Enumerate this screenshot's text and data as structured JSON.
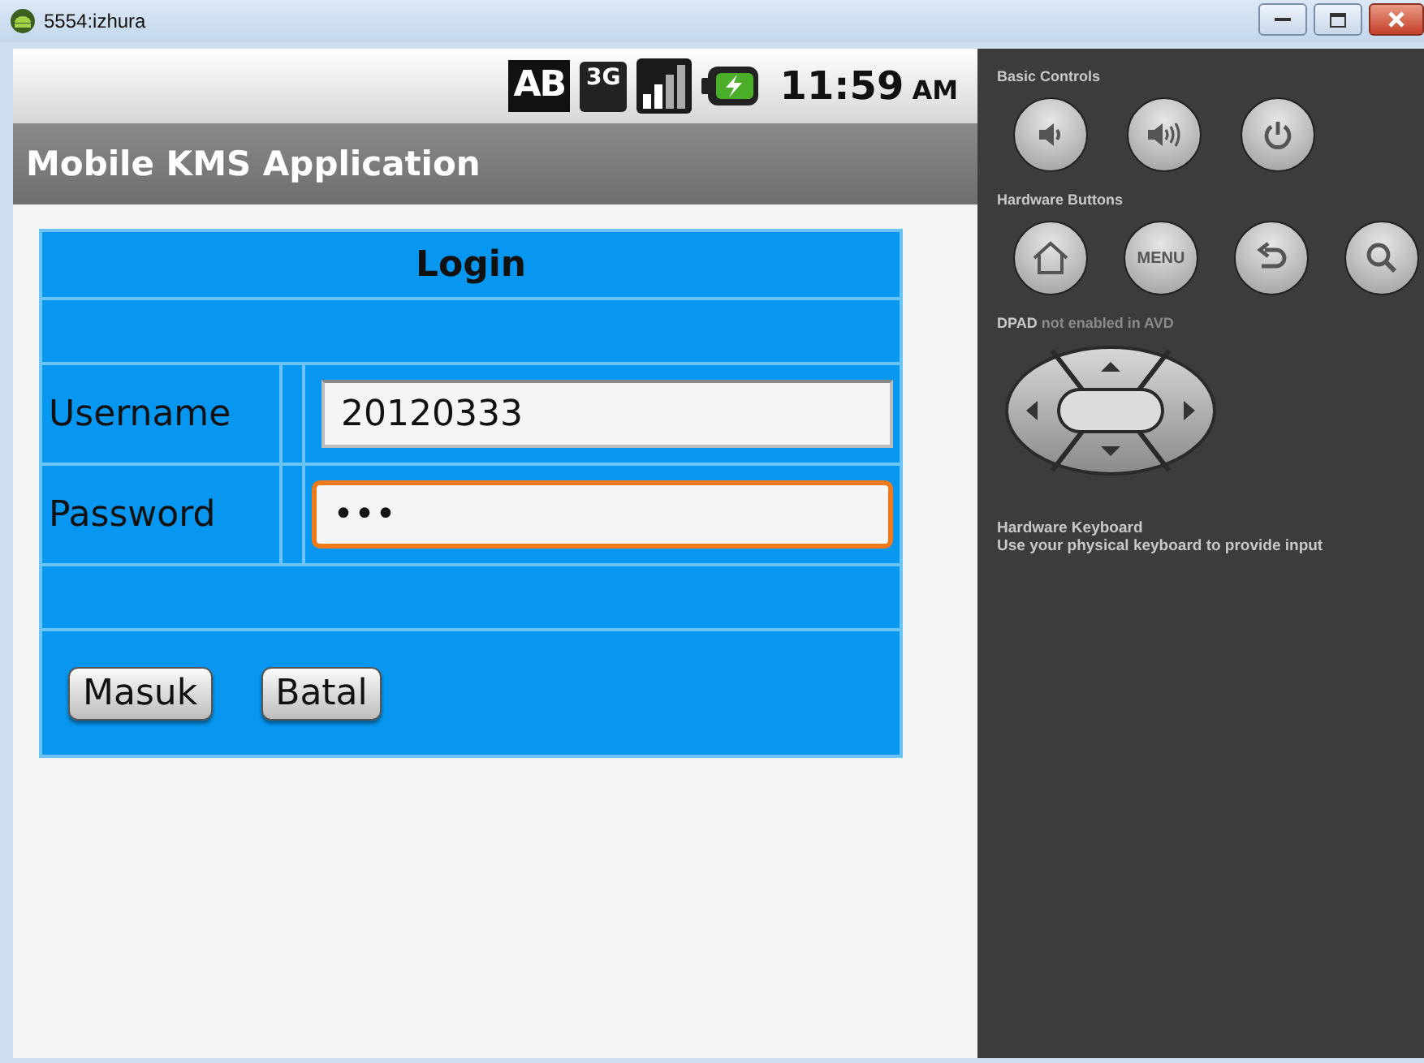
{
  "window": {
    "title": "5554:izhura"
  },
  "status_bar": {
    "badges": [
      "AB",
      "3G"
    ],
    "time": "11:59",
    "meridiem": "AM"
  },
  "app_bar": {
    "title": "Mobile KMS Application"
  },
  "form": {
    "title": "Login",
    "fields": [
      {
        "label": "Username",
        "value": "20120333",
        "focused": false
      },
      {
        "label": "Password",
        "value": "•••",
        "focused": true
      }
    ],
    "buttons": [
      "Masuk",
      "Batal"
    ]
  },
  "controls": {
    "basic_label": "Basic Controls",
    "hardware_label": "Hardware Buttons",
    "menu_label": "MENU",
    "dpad_label": "**DPAD** not enabled in AVD",
    "keyboard_title": "Hardware Keyboard",
    "keyboard_text": "Use your physical keyboard to provide input"
  }
}
